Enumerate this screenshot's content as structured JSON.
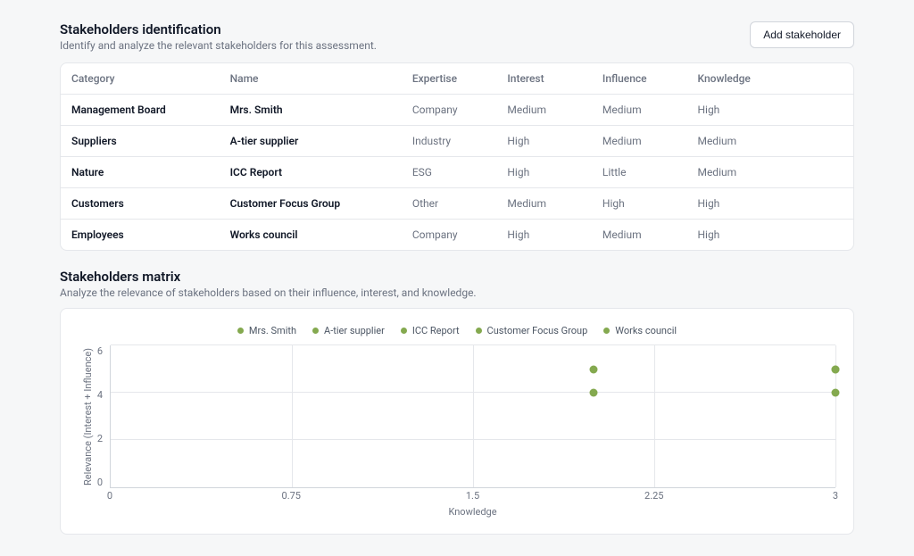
{
  "section1": {
    "title": "Stakeholders identification",
    "subtitle": "Identify and analyze the relevant stakeholders for this assessment.",
    "add_button": "Add stakeholder"
  },
  "table": {
    "headers": {
      "category": "Category",
      "name": "Name",
      "expertise": "Expertise",
      "interest": "Interest",
      "influence": "Influence",
      "knowledge": "Knowledge"
    },
    "rows": [
      {
        "category": "Management Board",
        "name": "Mrs. Smith",
        "expertise": "Company",
        "interest": "Medium",
        "influence": "Medium",
        "knowledge": "High"
      },
      {
        "category": "Suppliers",
        "name": "A-tier supplier",
        "expertise": "Industry",
        "interest": "High",
        "influence": "Medium",
        "knowledge": "Medium"
      },
      {
        "category": "Nature",
        "name": "ICC Report",
        "expertise": "ESG",
        "interest": "High",
        "influence": "Little",
        "knowledge": "Medium"
      },
      {
        "category": "Customers",
        "name": "Customer Focus Group",
        "expertise": "Other",
        "interest": "Medium",
        "influence": "High",
        "knowledge": "High"
      },
      {
        "category": "Employees",
        "name": "Works council",
        "expertise": "Company",
        "interest": "High",
        "influence": "Medium",
        "knowledge": "High"
      }
    ]
  },
  "section2": {
    "title": "Stakeholders matrix",
    "subtitle": "Analyze the relevance of stakeholders based on their influence, interest, and knowledge."
  },
  "legend": [
    "Mrs. Smith",
    "A-tier supplier",
    "ICC Report",
    "Customer Focus Group",
    "Works council"
  ],
  "chart_data": {
    "type": "scatter",
    "xlabel": "Knowledge",
    "ylabel": "Relevance (Interest + Influence)",
    "xlim": [
      0,
      3
    ],
    "ylim": [
      0,
      6
    ],
    "xticks": [
      0,
      0.75,
      1.5,
      2.25,
      3
    ],
    "yticks": [
      0,
      2,
      4,
      6
    ],
    "series": [
      {
        "name": "Mrs. Smith",
        "x": 3,
        "y": 4
      },
      {
        "name": "A-tier supplier",
        "x": 2,
        "y": 5
      },
      {
        "name": "ICC Report",
        "x": 2,
        "y": 4
      },
      {
        "name": "Customer Focus Group",
        "x": 3,
        "y": 5
      },
      {
        "name": "Works council",
        "x": 3,
        "y": 5
      }
    ],
    "color": "#84a94f"
  }
}
